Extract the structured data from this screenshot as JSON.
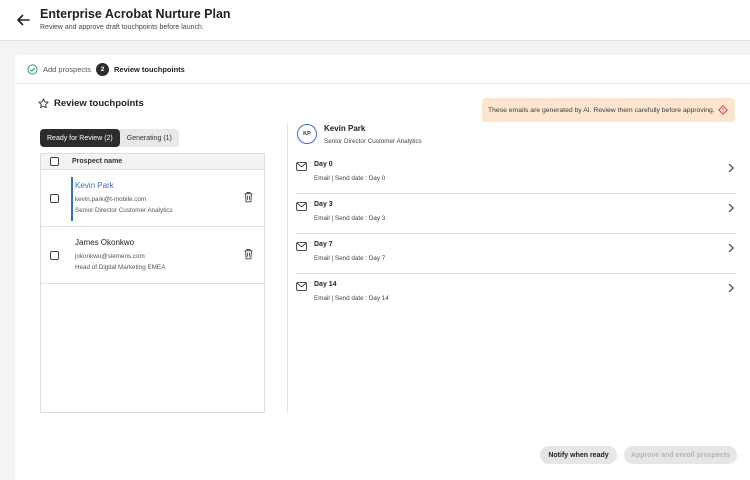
{
  "header": {
    "title": "Enterprise Acrobat Nurture Plan",
    "subtitle": "Review and approve draft touchpoints before launch."
  },
  "steps": [
    {
      "label": "Add prospects",
      "status": "complete"
    },
    {
      "number": "2",
      "label": "Review touchpoints",
      "status": "current"
    }
  ],
  "section": {
    "title": "Review touchpoints",
    "ai_notice": "These emails are generated by AI. Review them carefully before approving."
  },
  "tabs": [
    {
      "label": "Ready for Review (2)",
      "active": true
    },
    {
      "label": "Generating (1)",
      "active": false
    }
  ],
  "list": {
    "column_header": "Prospect name",
    "prospects": [
      {
        "name": "Kevin Park",
        "email": "kevin.park@t-mobile.com",
        "title": "Senior Director Customer Analytics",
        "selected": true
      },
      {
        "name": "James Okonkwo",
        "email": "jokonkwo@siemens.com",
        "title": "Head of Digital Marketing EMEA",
        "selected": false
      }
    ]
  },
  "detail": {
    "initials": "KP",
    "name": "Kevin Park",
    "role": "Senior Director Customer Analytics",
    "touchpoints": [
      {
        "day": "Day 0",
        "meta": "Email | Send date : Day 0"
      },
      {
        "day": "Day 3",
        "meta": "Email | Send date : Day 3"
      },
      {
        "day": "Day 7",
        "meta": "Email | Send date : Day 7"
      },
      {
        "day": "Day 14",
        "meta": "Email | Send date : Day 14"
      }
    ]
  },
  "actions": {
    "notify_label": "Notify when ready",
    "approve_label": "Approve and enroll prospects"
  },
  "colors": {
    "accent_blue": "#2f6fd9",
    "notice_bg": "#fde6cf",
    "check_green": "#2d9d78",
    "warning_red": "#d7373f"
  }
}
